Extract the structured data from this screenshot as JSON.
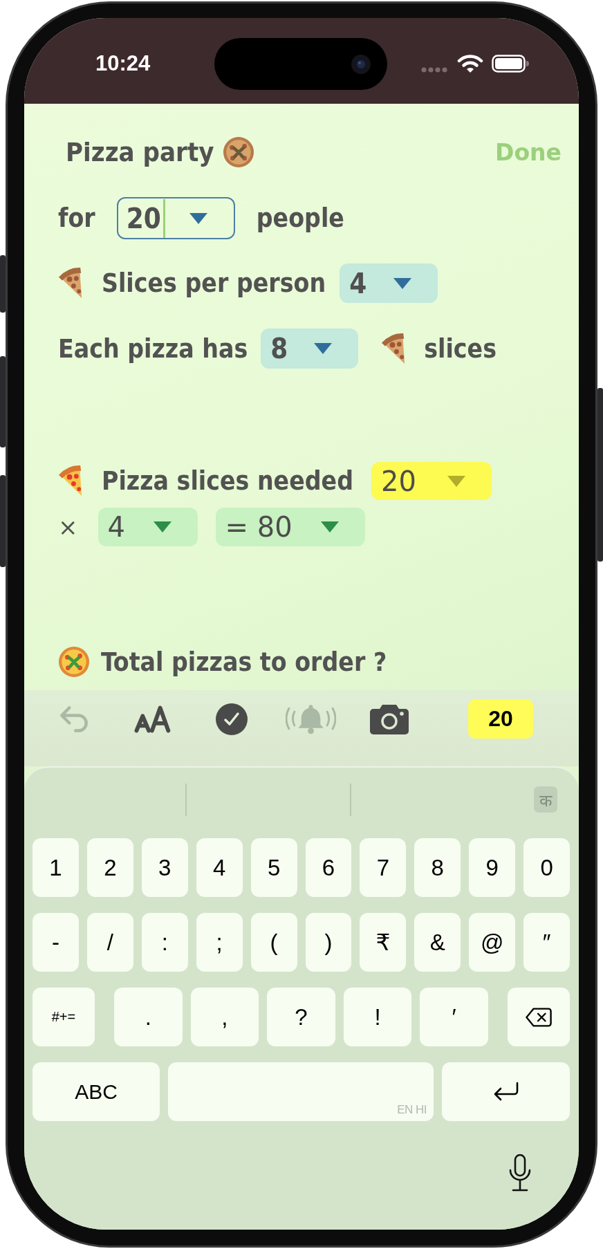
{
  "status_bar": {
    "time": "10:24"
  },
  "header": {
    "title": "Pizza party",
    "done_button": "Done"
  },
  "people_row": {
    "prefix": "for",
    "value": "20",
    "suffix": "people",
    "focused": true
  },
  "slices_per_person_row": {
    "label": "Slices per person",
    "value": "4"
  },
  "slices_per_pizza_row": {
    "label": "Each pizza has",
    "value": "8",
    "suffix": "slices"
  },
  "slices_needed_row": {
    "label": "Pizza slices needed",
    "value": "20"
  },
  "calculation_row": {
    "operator": "×",
    "factor": "4",
    "result": "= 80"
  },
  "total_row": {
    "label": "Total pizzas to order ?"
  },
  "toolbar": {
    "items": [
      {
        "kind": "undo",
        "disabled": true
      },
      {
        "kind": "text-size",
        "disabled": false
      },
      {
        "kind": "check",
        "disabled": false
      },
      {
        "kind": "bell",
        "disabled": true
      },
      {
        "kind": "camera",
        "disabled": false
      }
    ],
    "result_badge": "20"
  },
  "keyboard": {
    "language_key": "क",
    "number_keys": [
      "1",
      "2",
      "3",
      "4",
      "5",
      "6",
      "7",
      "8",
      "9",
      "0"
    ],
    "symbol_keys": [
      "-",
      "/",
      ":",
      ";",
      "(",
      ")",
      "₹",
      "&",
      "@",
      "″"
    ],
    "punctuation_row": {
      "toggle_key": "#+=",
      "keys": [
        ".",
        ",",
        "?",
        "!",
        "′"
      ]
    },
    "bottom_row": {
      "letters_key": "ABC",
      "space_key": "EN HI"
    }
  }
}
